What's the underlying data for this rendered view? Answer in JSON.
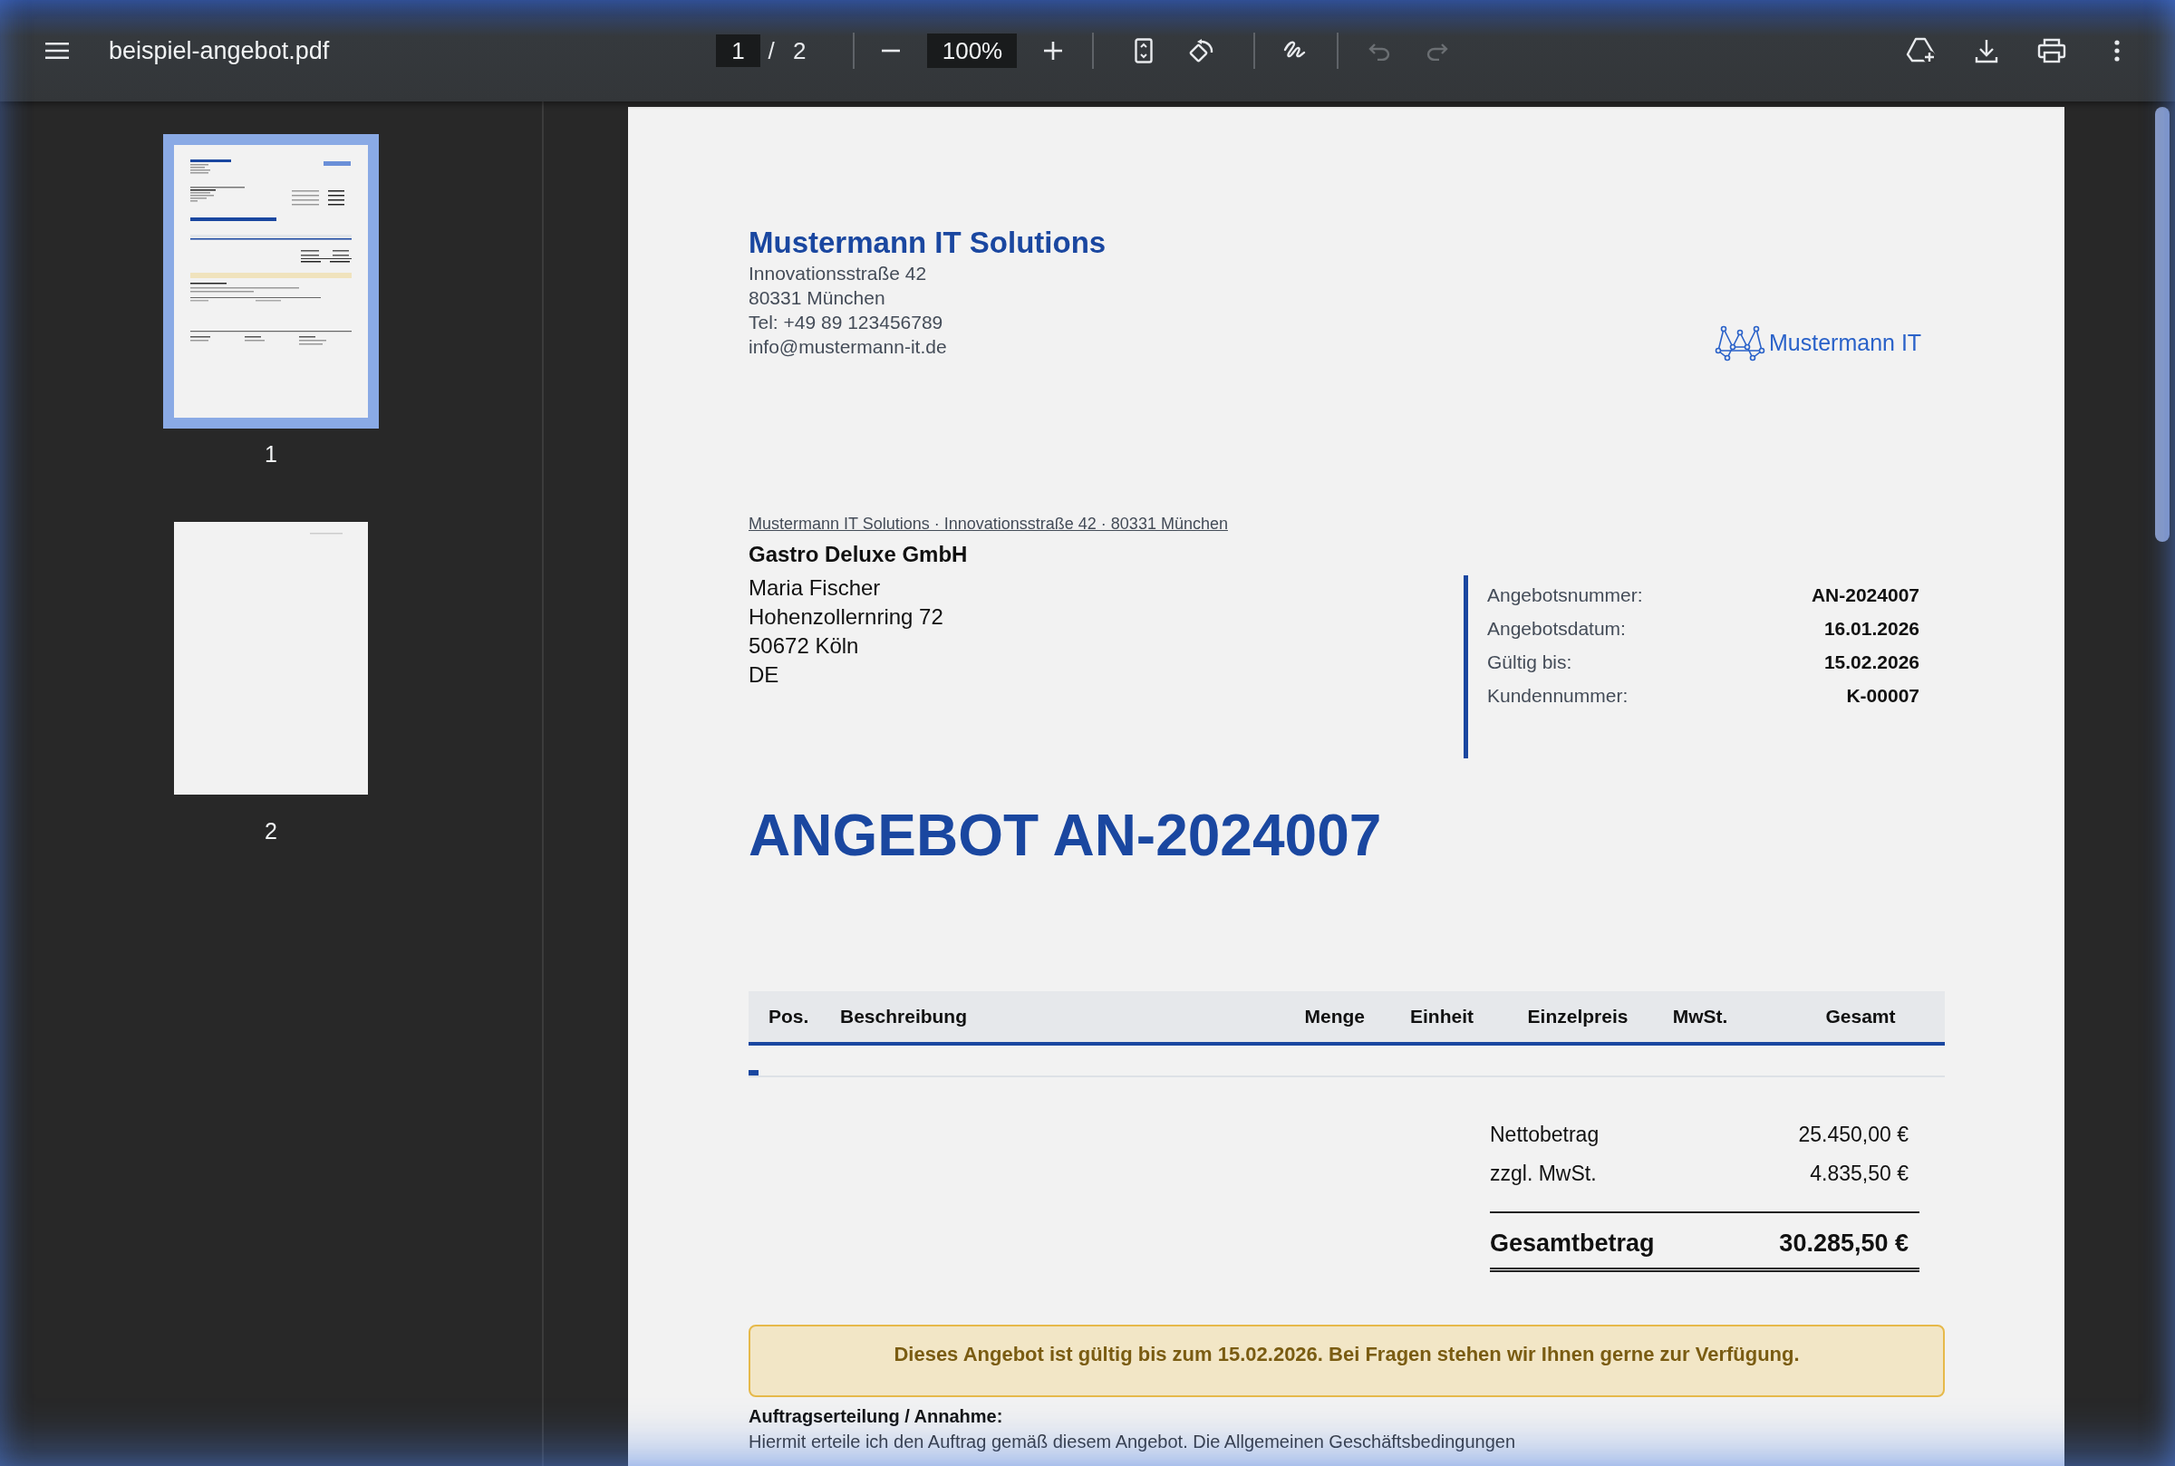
{
  "toolbar": {
    "title": "beispiel-angebot.pdf",
    "page": "1",
    "page_separator": "/",
    "page_count": "2",
    "zoom": "100%",
    "undo_disabled": true,
    "redo_disabled": true
  },
  "thumbnails": [
    {
      "label": "1",
      "selected": true,
      "kind": "full"
    },
    {
      "label": "2",
      "selected": false,
      "kind": "blank"
    }
  ],
  "document": {
    "company": {
      "name": "Mustermann IT Solutions",
      "lines": [
        "Innovationsstraße 42",
        "80331 München",
        "Tel: +49 89 123456789",
        "info@mustermann-it.de"
      ]
    },
    "logo_text": "Mustermann IT",
    "sender_line": "Mustermann IT Solutions · Innovationsstraße 42 · 80331 München",
    "recipient": {
      "company": "Gastro Deluxe GmbH",
      "lines": [
        "Maria Fischer",
        "Hohenzollernring 72",
        "50672 Köln",
        "DE"
      ]
    },
    "info": [
      {
        "label": "Angebotsnummer:",
        "value": "AN-2024007"
      },
      {
        "label": "Angebotsdatum:",
        "value": "16.01.2026"
      },
      {
        "label": "Gültig bis:",
        "value": "15.02.2026"
      },
      {
        "label": "Kundennummer:",
        "value": "K-00007"
      }
    ],
    "title": "ANGEBOT AN-2024007",
    "table": {
      "columns": [
        "Pos.",
        "Beschreibung",
        "Menge",
        "Einheit",
        "Einzelpreis",
        "MwSt.",
        "Gesamt"
      ]
    },
    "totals": [
      {
        "label": "Nettobetrag",
        "value": "25.450,00 €",
        "kind": "line"
      },
      {
        "label": "zzgl. MwSt.",
        "value": "4.835,50 €",
        "kind": "line"
      },
      {
        "label": "Gesamtbetrag",
        "value": "30.285,50 €",
        "kind": "grand"
      }
    ],
    "notice": "Dieses Angebot ist gültig bis zum 15.02.2026. Bei Fragen stehen wir Ihnen gerne zur Verfügung.",
    "acceptance_heading": "Auftragserteilung / Annahme:",
    "acceptance_text": "Hiermit erteile ich den Auftrag gemäß diesem Angebot. Die Allgemeinen Geschäftsbedingungen"
  }
}
